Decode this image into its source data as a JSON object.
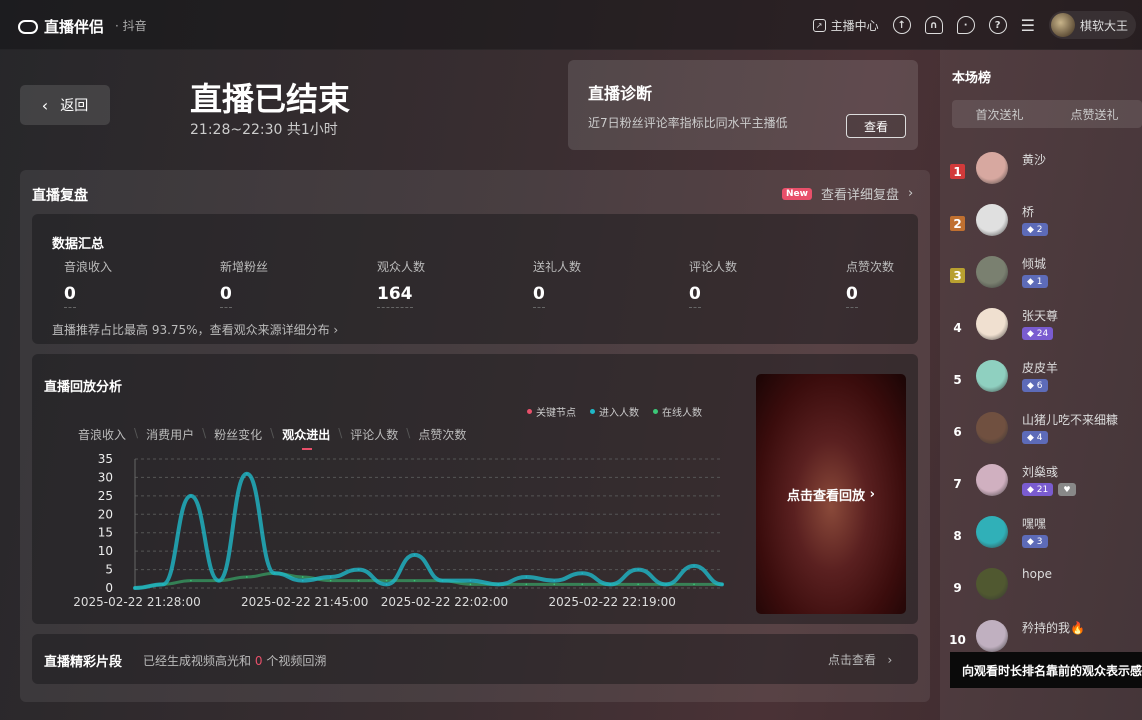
{
  "app": {
    "name": "直播伴侣",
    "platform": "· 抖音"
  },
  "topbar": {
    "anchor_center": "主播中心",
    "upload_icon": "upload-icon",
    "headset_icon": "headset-icon",
    "chat_icon": "chat-icon",
    "help_icon": "help-icon",
    "menu_icon": "menu-icon",
    "username": "棋软大王"
  },
  "header": {
    "back": "返回",
    "title": "直播已结束",
    "time": "21:28~22:30 共1小时"
  },
  "diagnosis": {
    "title": "直播诊断",
    "desc": "近7日粉丝评论率指标比同水平主播低",
    "button": "查看"
  },
  "review": {
    "title": "直播复盘",
    "new_badge": "New",
    "detail_link": "查看详细复盘"
  },
  "summary": {
    "title": "数据汇总",
    "metrics": [
      {
        "label": "音浪收入",
        "value": "0"
      },
      {
        "label": "新增粉丝",
        "value": "0"
      },
      {
        "label": "观众人数",
        "value": "164"
      },
      {
        "label": "送礼人数",
        "value": "0"
      },
      {
        "label": "评论人数",
        "value": "0"
      },
      {
        "label": "点赞次数",
        "value": "0"
      }
    ],
    "footer": "直播推荐占比最高 93.75%，查看观众来源详细分布"
  },
  "analysis": {
    "title": "直播回放分析",
    "legend": [
      {
        "label": "关键节点",
        "color": "#e8506a"
      },
      {
        "label": "进入人数",
        "color": "#1fb8c8"
      },
      {
        "label": "在线人数",
        "color": "#3cc878"
      }
    ],
    "tabs": [
      "音浪收入",
      "消费用户",
      "粉丝变化",
      "观众进出",
      "评论人数",
      "点赞次数"
    ],
    "active_tab": 3,
    "replay_label": "点击查看回放"
  },
  "chart_data": {
    "type": "line",
    "x": [
      "21:28",
      "21:31",
      "21:34",
      "21:37",
      "21:40",
      "21:43",
      "21:46",
      "21:49",
      "21:52",
      "21:55",
      "21:58",
      "22:01",
      "22:04",
      "22:07",
      "22:10",
      "22:13",
      "22:16",
      "22:19",
      "22:22",
      "22:25",
      "22:28",
      "22:30"
    ],
    "x_tick_labels": [
      "2025-02-22 21:28:00",
      "2025-02-22 21:45:00",
      "2025-02-22 22:02:00",
      "2025-02-22 22:19:00"
    ],
    "series": [
      {
        "name": "进入人数",
        "color": "#1fb8c8",
        "values": [
          0,
          1,
          25,
          2,
          31,
          4,
          2,
          3,
          5,
          1,
          9,
          2,
          2,
          1,
          3,
          2,
          4,
          1,
          5,
          1,
          6,
          1
        ]
      },
      {
        "name": "在线人数",
        "color": "#3cc878",
        "values": [
          0,
          1,
          2,
          2,
          3,
          4,
          3,
          2,
          2,
          2,
          2,
          2,
          1,
          1,
          1,
          1,
          1,
          1,
          1,
          1,
          1,
          1
        ]
      }
    ],
    "ylim": [
      0,
      35
    ],
    "yticks": [
      0,
      5,
      10,
      15,
      20,
      25,
      30,
      35
    ],
    "grid": true
  },
  "highlight": {
    "title": "直播精彩片段",
    "desc_pre": "已经生成视频高光和",
    "count": "0",
    "desc_post": "个视频回溯",
    "link": "点击查看"
  },
  "ranking": {
    "title": "本场榜",
    "tabs": [
      "首次送礼",
      "点赞送礼"
    ],
    "items": [
      {
        "rank": "1",
        "name": "黄沙",
        "badge": "",
        "color": "#d7a8a0"
      },
      {
        "rank": "2",
        "name": "桥",
        "badge": "2",
        "color": "#e0e0e0"
      },
      {
        "rank": "3",
        "name": "倾城",
        "badge": "1",
        "color": "#7a8070"
      },
      {
        "rank": "4",
        "name": "张天尊",
        "badge": "24",
        "color": "#f0e0d0"
      },
      {
        "rank": "5",
        "name": "皮皮羊",
        "badge": "6",
        "color": "#8fd0c0"
      },
      {
        "rank": "6",
        "name": "山猪儿吃不来细糠",
        "badge": "4",
        "color": "#705040"
      },
      {
        "rank": "7",
        "name": "刘燊彧",
        "badge": "21",
        "color": "#d0b0c0"
      },
      {
        "rank": "8",
        "name": "嘿嘿",
        "badge": "3",
        "color": "#30b0b8"
      },
      {
        "rank": "9",
        "name": "hope",
        "badge": "",
        "color": "#505830"
      },
      {
        "rank": "10",
        "name": "矜持的我🔥",
        "badge": "",
        "color": "#c0b0c0"
      }
    ],
    "tooltip": "向观看时长排名靠前的观众表示感谢"
  }
}
